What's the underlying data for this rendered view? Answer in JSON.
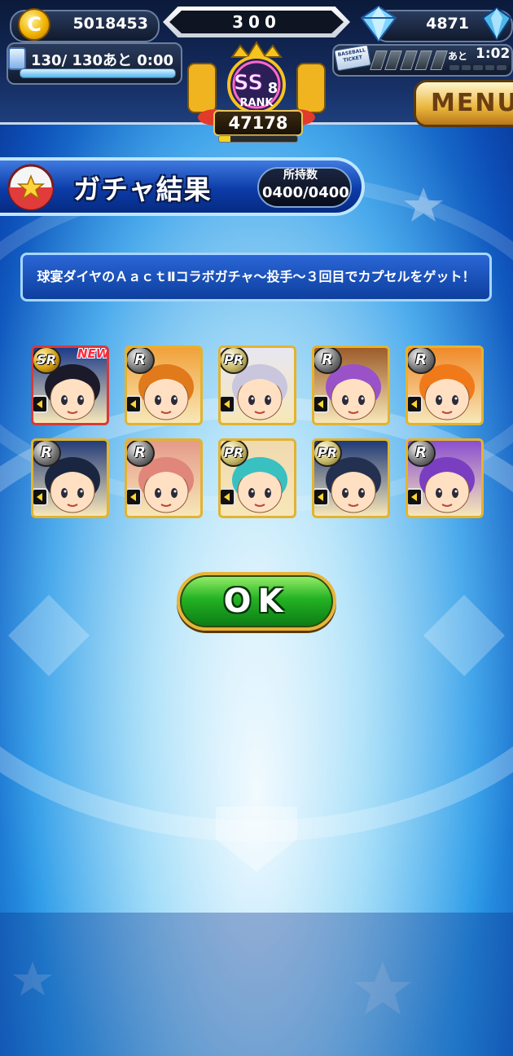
{
  "header": {
    "coins": "5018453",
    "coin_symbol": "C",
    "stamina_label": "300",
    "diamonds": "4871",
    "stamina_text": "130/ 130あと  0:00",
    "stamina_fraction": 1.0,
    "rank_tier": "SS",
    "rank_level": "8",
    "rank_word": "RANK",
    "rank_value": "47178",
    "rank_progress": 0.15,
    "ticket_label": "BASEBALL TICKET",
    "ticket_ato": "あと",
    "ticket_timer": "1:02",
    "menu_label": "MENU"
  },
  "title": {
    "text": "ガチャ結果",
    "count_label": "所持数",
    "count_value": "0400/0400"
  },
  "message": "球宴ダイヤのＡａｃｔⅡコラボガチャ～投手～３回目でカプセルをゲット！",
  "cards": [
    {
      "rarity": "SR",
      "badge": "NEW",
      "frame": "#d63a3a",
      "bg": "#1d3b8a",
      "hair": "#1a1a2a"
    },
    {
      "rarity": "R",
      "badge": "",
      "frame": "#e3b32f",
      "bg": "#f2a23a",
      "hair": "#e07a1a"
    },
    {
      "rarity": "PR",
      "badge": "",
      "frame": "#e3b32f",
      "bg": "#e7e7f2",
      "hair": "#c9c6dd"
    },
    {
      "rarity": "R",
      "badge": "",
      "frame": "#e3b32f",
      "bg": "#9d5c2a",
      "hair": "#9a52c9"
    },
    {
      "rarity": "R",
      "badge": "",
      "frame": "#e3b32f",
      "bg": "#f08a2a",
      "hair": "#f07a1a"
    },
    {
      "rarity": "R",
      "badge": "",
      "frame": "#e3b32f",
      "bg": "#233c7a",
      "hair": "#1a2540"
    },
    {
      "rarity": "R",
      "badge": "",
      "frame": "#e3b32f",
      "bg": "#e59a8a",
      "hair": "#e0867a"
    },
    {
      "rarity": "PR",
      "badge": "",
      "frame": "#e3b32f",
      "bg": "#f0d9b0",
      "hair": "#39c0c0"
    },
    {
      "rarity": "PR",
      "badge": "",
      "frame": "#e3b32f",
      "bg": "#1f3a78",
      "hair": "#243050"
    },
    {
      "rarity": "R",
      "badge": "",
      "frame": "#e3b32f",
      "bg": "#8a4fd0",
      "hair": "#7a3fc0"
    }
  ],
  "ok_label": "OK",
  "icons": {
    "coin": "coin-icon",
    "diamond": "diamond-icon",
    "bottle": "stamina-bottle-icon",
    "ticket": "baseball-ticket-icon",
    "capsule": "capsule-icon",
    "arrow": "diamond-arrow-icon"
  },
  "colors": {
    "accent_blue": "#0c3ca8",
    "ok_green": "#24b224",
    "gold": "#e6b53a"
  }
}
